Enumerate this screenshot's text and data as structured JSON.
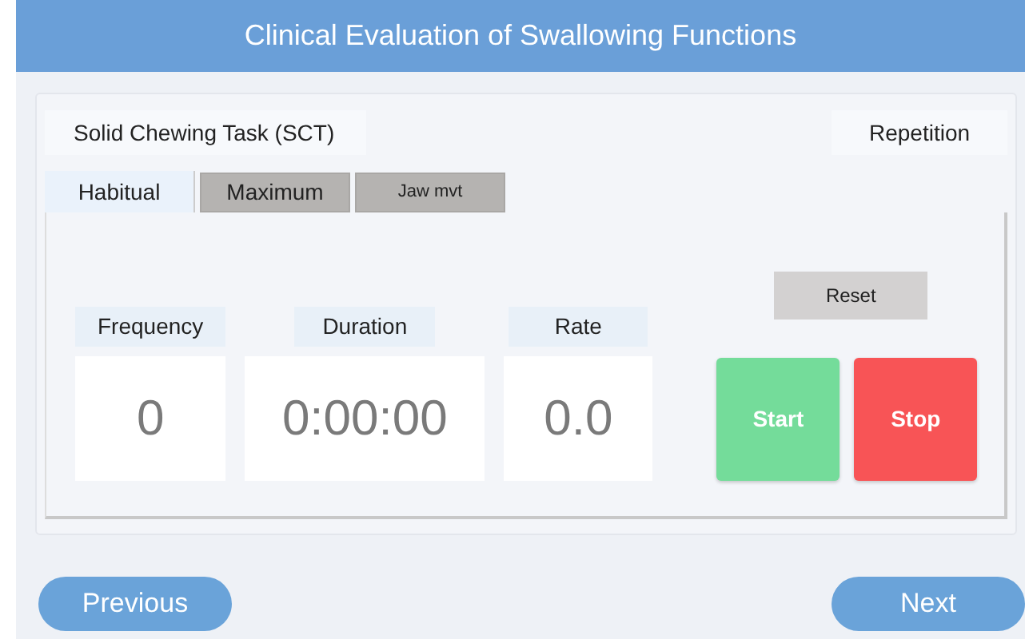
{
  "window": {
    "title": "Clinical Evaluation of Swallowing Functions"
  },
  "task": {
    "name": "Solid Chewing Task (SCT)",
    "mode": "Repetition"
  },
  "tabs": [
    {
      "label": "Habitual",
      "selected": true
    },
    {
      "label": "Maximum",
      "selected": false
    },
    {
      "label": "Jaw mvt",
      "selected": false
    }
  ],
  "metrics": [
    {
      "label": "Frequency",
      "value": "0"
    },
    {
      "label": "Duration",
      "value": "0:00:00"
    },
    {
      "label": "Rate",
      "value": "0.0"
    }
  ],
  "controls": [
    {
      "label": "Reset",
      "kind": "reset"
    },
    {
      "label": "Start",
      "kind": "start"
    },
    {
      "label": "Stop",
      "kind": "stop"
    }
  ],
  "navigation": [
    {
      "label": "Previous",
      "kind": "back"
    },
    {
      "label": "Next",
      "kind": "forward"
    }
  ]
}
